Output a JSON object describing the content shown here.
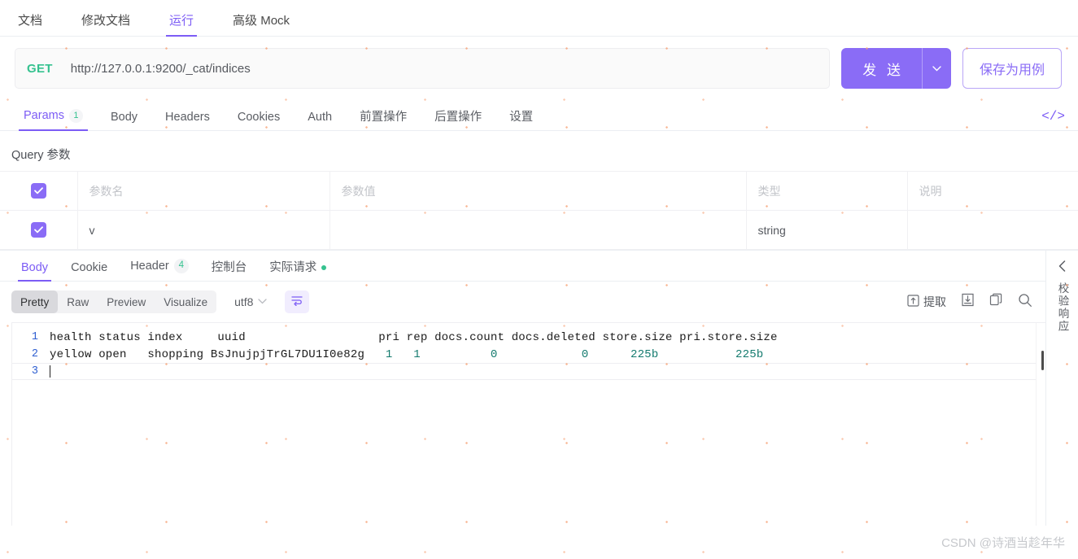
{
  "top_tabs": [
    {
      "label": "文档",
      "active": false
    },
    {
      "label": "修改文档",
      "active": false
    },
    {
      "label": "运行",
      "active": true
    },
    {
      "label": "高级 Mock",
      "active": false
    }
  ],
  "request": {
    "method": "GET",
    "url": "http://127.0.0.1:9200/_cat/indices",
    "send_label": "发 送",
    "send_caret_icon": "chevron-down-icon",
    "save_label": "保存为用例"
  },
  "request_tabs": [
    {
      "label": "Params",
      "badge": "1",
      "active": true
    },
    {
      "label": "Body",
      "badge": "",
      "active": false
    },
    {
      "label": "Headers",
      "badge": "",
      "active": false
    },
    {
      "label": "Cookies",
      "badge": "",
      "active": false
    },
    {
      "label": "Auth",
      "badge": "",
      "active": false
    },
    {
      "label": "前置操作",
      "badge": "",
      "active": false
    },
    {
      "label": "后置操作",
      "badge": "",
      "active": false
    },
    {
      "label": "设置",
      "badge": "",
      "active": false
    }
  ],
  "code_view_icon": "</>",
  "query": {
    "title": "Query 参数",
    "columns": [
      "参数名",
      "参数值",
      "类型",
      "说明"
    ],
    "header_row": {
      "checked": true,
      "name_placeholder": "参数名",
      "value_placeholder": "参数值",
      "type_placeholder": "类型",
      "desc_placeholder": "说明"
    },
    "rows": [
      {
        "checked": true,
        "name": "v",
        "value": "",
        "type": "string",
        "desc": ""
      }
    ]
  },
  "response_tabs": [
    {
      "label": "Body",
      "badge": "",
      "dot": false,
      "active": true
    },
    {
      "label": "Cookie",
      "badge": "",
      "dot": false,
      "active": false
    },
    {
      "label": "Header",
      "badge": "4",
      "dot": false,
      "active": false
    },
    {
      "label": "控制台",
      "badge": "",
      "dot": false,
      "active": false
    },
    {
      "label": "实际请求",
      "badge": "",
      "dot": true,
      "active": false
    }
  ],
  "format_bar": {
    "segments": [
      {
        "label": "Pretty",
        "active": true
      },
      {
        "label": "Raw",
        "active": false
      },
      {
        "label": "Preview",
        "active": false
      },
      {
        "label": "Visualize",
        "active": false
      }
    ],
    "encoding": "utf8",
    "encoding_caret_icon": "chevron-down-icon",
    "wrap_icon": "word-wrap-icon",
    "extract_label": "提取",
    "extract_icon": "extract-icon",
    "download_icon": "download-icon",
    "copy_icon": "copy-icon",
    "search_icon": "search-icon"
  },
  "code": {
    "lines": [
      {
        "num": "1",
        "text": "health status index     uuid                   pri rep docs.count docs.deleted store.size pri.store.size",
        "active": false
      },
      {
        "num": "2",
        "text": "yellow open   shopping BsJnujpjTrGL7DU1I0e82g   1   1          0            0      225b           225b",
        "active": false
      },
      {
        "num": "3",
        "text": "",
        "active": true
      }
    ]
  },
  "right_rail": {
    "collapse_icon": "chevron-left-icon",
    "vertical_label": "校验响应"
  },
  "watermark": "CSDN @诗酒当趁年华",
  "colors": {
    "accent": "#7c5cf5",
    "method": "#35c28f",
    "number": "#137a6e",
    "linenum": "#2f5fd1"
  }
}
